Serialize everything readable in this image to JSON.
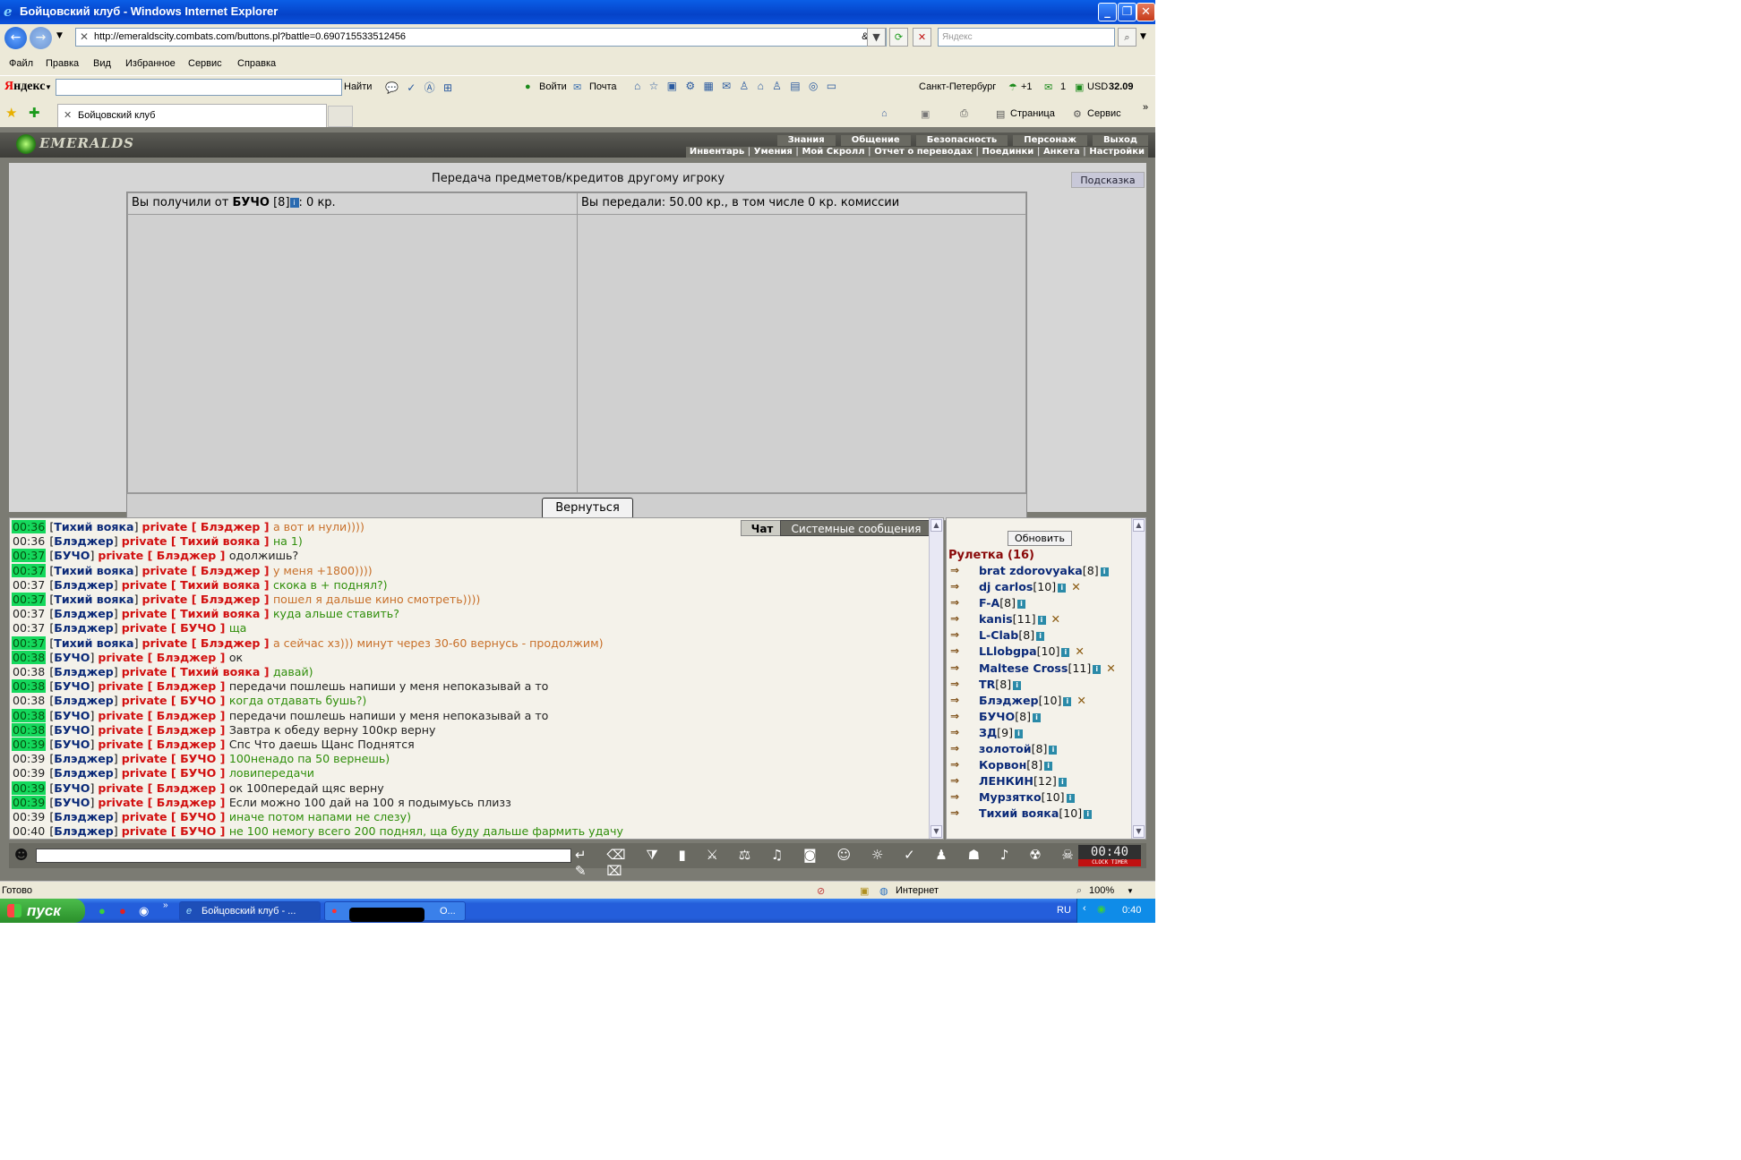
{
  "window": {
    "title": "Бойцовский клуб - Windows Internet Explorer",
    "controls": [
      "minimize",
      "maximize",
      "close"
    ]
  },
  "address_bar": {
    "url": "http://emeraldscity.combats.com/buttons.pl?battle=0.690715533512456",
    "lang_indicator": "&En",
    "search_placeholder": "Яндекс"
  },
  "menu": [
    "Файл",
    "Правка",
    "Вид",
    "Избранное",
    "Сервис",
    "Справка"
  ],
  "yandex_bar": {
    "logo": "Яндекс",
    "find": "Найти",
    "login": "Войти",
    "mail": "Почта",
    "city": "Санкт-Петербург",
    "weather": "+1",
    "mail_count": "1",
    "currency_label": "USD",
    "currency_value": "32.09"
  },
  "tabs": {
    "active_tab": "Бойцовский клуб",
    "page_menu": "Страница",
    "service_menu": "Сервис"
  },
  "game": {
    "logo": "EMERALDS",
    "nav_top": [
      "Знания",
      "Общение",
      "Безопасность",
      "Персонаж",
      "Выход"
    ],
    "nav_sub": [
      "Инвентарь",
      "Умения",
      "Мой Скролл",
      "Отчет о переводах",
      "Поединки",
      "Анкета",
      "Настройки"
    ],
    "page_title": "Передача предметов/кредитов другому игроку",
    "hint_button": "Подсказка",
    "received": {
      "prefix": "Вы получили от",
      "player": "БУЧО",
      "level": "[8]",
      "suffix": ": 0 кр."
    },
    "sent": "Вы передали: 50.00 кр., в том числе 0 кр. комиссии",
    "back_button": "Вернуться"
  },
  "chat": {
    "tabs": [
      "Чат",
      "Системные сообщения"
    ],
    "lines": [
      {
        "time": "00:36",
        "hl": true,
        "from": "Тихий вояка",
        "to": "Блэджер",
        "msg": "а вот и нули))))",
        "color": "orange"
      },
      {
        "time": "00:36",
        "hl": false,
        "from": "Блэджер",
        "to": "Тихий вояка",
        "msg": "на 1)",
        "color": "green"
      },
      {
        "time": "00:37",
        "hl": true,
        "from": "БУЧО",
        "to": "Блэджер",
        "msg": "одолжишь?",
        "color": "dark"
      },
      {
        "time": "00:37",
        "hl": true,
        "from": "Тихий вояка",
        "to": "Блэджер",
        "msg": "у меня +1800))))",
        "color": "orange"
      },
      {
        "time": "00:37",
        "hl": false,
        "from": "Блэджер",
        "to": "Тихий вояка",
        "msg": "скока в + поднял?)",
        "color": "green"
      },
      {
        "time": "00:37",
        "hl": true,
        "from": "Тихий вояка",
        "to": "Блэджер",
        "msg": "пошел я дальше кино смотреть))))",
        "color": "orange"
      },
      {
        "time": "00:37",
        "hl": false,
        "from": "Блэджер",
        "to": "Тихий вояка",
        "msg": "куда альше ставить?",
        "color": "green"
      },
      {
        "time": "00:37",
        "hl": false,
        "from": "Блэджер",
        "to": "БУЧО",
        "msg": "ща",
        "color": "green"
      },
      {
        "time": "00:37",
        "hl": true,
        "from": "Тихий вояка",
        "to": "Блэджер",
        "msg": "а сейчас хз))) минут через 30-60 вернусь - продолжим)",
        "color": "orange"
      },
      {
        "time": "00:38",
        "hl": true,
        "from": "БУЧО",
        "to": "Блэджер",
        "msg": "ок",
        "color": "dark"
      },
      {
        "time": "00:38",
        "hl": false,
        "from": "Блэджер",
        "to": "Тихий вояка",
        "msg": "давай)",
        "color": "green"
      },
      {
        "time": "00:38",
        "hl": true,
        "from": "БУЧО",
        "to": "Блэджер",
        "msg": "передачи пошлешь напиши у меня непоказывай а то",
        "color": "dark"
      },
      {
        "time": "00:38",
        "hl": false,
        "from": "Блэджер",
        "to": "БУЧО",
        "msg": "когда отдавать бушь?)",
        "color": "green"
      },
      {
        "time": "00:38",
        "hl": true,
        "from": "БУЧО",
        "to": "Блэджер",
        "msg": "передачи пошлешь напиши у меня непоказывай а то",
        "color": "dark"
      },
      {
        "time": "00:38",
        "hl": true,
        "from": "БУЧО",
        "to": "Блэджер",
        "msg": "Завтра к обеду верну 100кр верну",
        "color": "dark"
      },
      {
        "time": "00:39",
        "hl": true,
        "from": "БУЧО",
        "to": "Блэджер",
        "msg": "Спс Что даешь Щанс Поднятся",
        "color": "dark"
      },
      {
        "time": "00:39",
        "hl": false,
        "from": "Блэджер",
        "to": "БУЧО",
        "msg": "100ненадо па 50 вернешь)",
        "color": "green"
      },
      {
        "time": "00:39",
        "hl": false,
        "from": "Блэджер",
        "to": "БУЧО",
        "msg": "ловипередачи",
        "color": "green"
      },
      {
        "time": "00:39",
        "hl": true,
        "from": "БУЧО",
        "to": "Блэджер",
        "msg": "ок 100передай щяс верну",
        "color": "dark"
      },
      {
        "time": "00:39",
        "hl": true,
        "from": "БУЧО",
        "to": "Блэджер",
        "msg": "Если можно 100 дай на 100 я подымуьсь плизз",
        "color": "dark"
      },
      {
        "time": "00:39",
        "hl": false,
        "from": "Блэджер",
        "to": "БУЧО",
        "msg": "иначе потом напами не слезу)",
        "color": "green"
      },
      {
        "time": "00:40",
        "hl": false,
        "from": "Блэджер",
        "to": "БУЧО",
        "msg": "не 100 немогу всего 200 поднял, ща буду дальше фармить удачу",
        "color": "green"
      }
    ],
    "private_label": "private"
  },
  "users": {
    "refresh_button": "Обновить",
    "room": "Рулетка (16)",
    "list": [
      {
        "name": "brat zdorovyaka",
        "level": "[8]",
        "x": false
      },
      {
        "name": "dj carlos",
        "level": "[10]",
        "x": true
      },
      {
        "name": "F-A",
        "level": "[8]",
        "x": false
      },
      {
        "name": "kanis",
        "level": "[11]",
        "x": true
      },
      {
        "name": "L-Clab",
        "level": "[8]",
        "x": false
      },
      {
        "name": "LLlobgpa",
        "level": "[10]",
        "x": true
      },
      {
        "name": "Maltese Cross",
        "level": "[11]",
        "x": true
      },
      {
        "name": "TR",
        "level": "[8]",
        "x": false
      },
      {
        "name": "Блэджер",
        "level": "[10]",
        "x": true
      },
      {
        "name": "БУЧО",
        "level": "[8]",
        "x": false
      },
      {
        "name": "ЗД",
        "level": "[9]",
        "x": false
      },
      {
        "name": "золотой",
        "level": "[8]",
        "x": false
      },
      {
        "name": "Корвон",
        "level": "[8]",
        "x": false
      },
      {
        "name": "ЛЕНКИН",
        "level": "[12]",
        "x": false
      },
      {
        "name": "Мурзятко",
        "level": "[10]",
        "x": false
      },
      {
        "name": "Тихий вояка",
        "level": "[10]",
        "x": false
      }
    ]
  },
  "clock": {
    "time": "00:40",
    "label": "CLOCK TIMER"
  },
  "status_bar": {
    "left": "Готово",
    "zone": "Интернет",
    "zoom": "100%"
  },
  "taskbar": {
    "start": "пуск",
    "task1": "Бойцовский клуб - ...",
    "task2": "О...",
    "lang": "RU",
    "time": "0:40"
  },
  "colors": {
    "accent_time_hl": "#14d85c",
    "private": "#d21010",
    "nick": "#0b2a78"
  }
}
